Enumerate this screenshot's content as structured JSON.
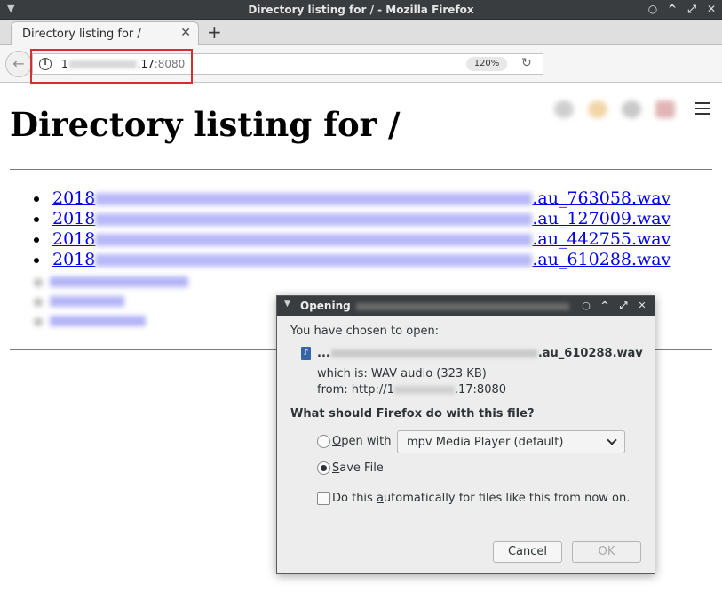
{
  "window": {
    "title": "Directory listing for / - Mozilla Firefox",
    "controls": {
      "minimize": "^",
      "restore": "⤢",
      "close": "✕",
      "pin": "○"
    }
  },
  "tabs": [
    {
      "label": "Directory listing for /",
      "close": "✕"
    }
  ],
  "newtab_label": "+",
  "navbar": {
    "back": "←",
    "url_prefix": "1",
    "url_suffix": ".17",
    "url_port": ":8080",
    "zoom": "120%",
    "reload": "↻"
  },
  "page": {
    "heading": "Directory listing for /",
    "files": [
      {
        "prefix": "2018",
        "suffix": ".au_763058.wav"
      },
      {
        "prefix": "2018",
        "suffix": ".au_127009.wav"
      },
      {
        "prefix": "2018",
        "suffix": ".au_442755.wav"
      },
      {
        "prefix": "2018",
        "suffix": ".au_610288.wav"
      }
    ]
  },
  "dialog": {
    "title": "Opening",
    "intro": "You have chosen to open:",
    "filename_prefix": "...",
    "filename_suffix": ".au_610288.wav",
    "which_is": "which is: WAV audio (323 KB)",
    "from_prefix": "from: http://1",
    "from_suffix": ".17:8080",
    "question": "What should Firefox do with this file?",
    "open_with_mnemonic": "O",
    "open_with_rest": "pen with",
    "open_with_app": "mpv Media Player (default)",
    "save_mnemonic": "S",
    "save_rest": "ave File",
    "auto_before": "Do this ",
    "auto_mnemonic": "a",
    "auto_after": "utomatically for files like this from now on.",
    "cancel": "Cancel",
    "ok": "OK",
    "selected_option": "save_file",
    "auto_checked": false
  },
  "colors": {
    "link": "#0000ee",
    "url_highlight": "#d23030",
    "titlebar": "#3a3d3f"
  }
}
